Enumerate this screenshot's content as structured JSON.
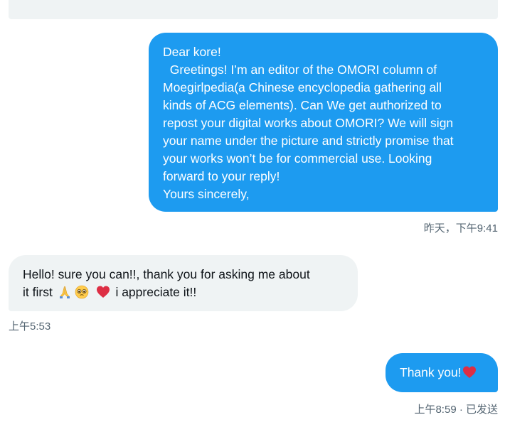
{
  "conversation": {
    "messages": [
      {
        "direction": "outgoing",
        "lines": [
          "Dear kore!",
          "  Greetings! I’m an editor of the OMORI column of",
          "Moegirlpedia(a Chinese encyclopedia gathering all",
          "kinds of ACG elements). Can We get authorized to",
          "repost your digital works about OMORI? We will sign",
          "your name under the picture and strictly promise that",
          "your works won’t be for commercial use. Looking",
          "forward to your reply!",
          "Yours sincerely,"
        ],
        "timestamp": "昨天，下午9:41"
      },
      {
        "direction": "incoming",
        "text_part1": "Hello! sure you can!!, thank you for asking me about",
        "text_part2": "it first",
        "text_part3": "i appreciate it!!",
        "emojis": [
          "folded-hands",
          "pleading-face",
          "red-heart"
        ],
        "timestamp": "上午5:53"
      },
      {
        "direction": "outgoing",
        "text": "Thank you!",
        "emojis": [
          "red-heart"
        ],
        "timestamp": "上午8:59 · 已发送"
      }
    ]
  },
  "colors": {
    "outgoing_bubble": "#1d9bf0",
    "incoming_bubble": "#eff3f4",
    "meta_text": "#536471",
    "heart": "#e0245e"
  }
}
